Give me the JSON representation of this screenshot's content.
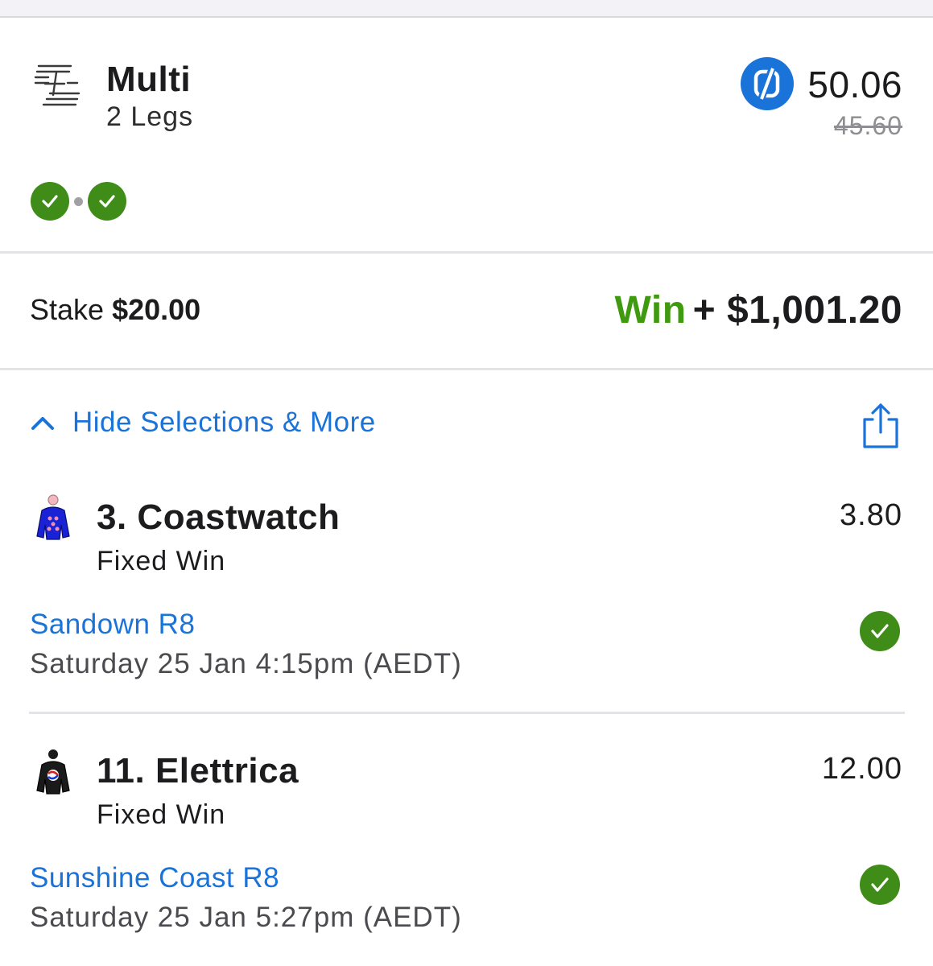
{
  "bet": {
    "title": "Multi",
    "legs_label": "2 Legs",
    "odds": "50.06",
    "original_odds": "45.60",
    "legs_status": [
      "won",
      "won"
    ]
  },
  "stake": {
    "label": "Stake",
    "value": "$20.00"
  },
  "win": {
    "label": "Win",
    "value": "+ $1,001.20",
    "color": "#3f9a0f"
  },
  "toggle": {
    "label": "Hide Selections & More"
  },
  "selections": [
    {
      "name": "3. Coastwatch",
      "bet_type": "Fixed Win",
      "odds": "3.80",
      "race": "Sandown R8",
      "time": "Saturday 25 Jan 4:15pm (AEDT)",
      "result": "won",
      "silk_color": "#1a22d6"
    },
    {
      "name": "11. Elettrica",
      "bet_type": "Fixed Win",
      "odds": "12.00",
      "race": "Sunshine Coast R8",
      "time": "Saturday 25 Jan 5:27pm (AEDT)",
      "result": "won",
      "silk_color": "#1a1a1a"
    }
  ],
  "colors": {
    "accent": "#1a73d9",
    "success": "#3f8d18"
  }
}
